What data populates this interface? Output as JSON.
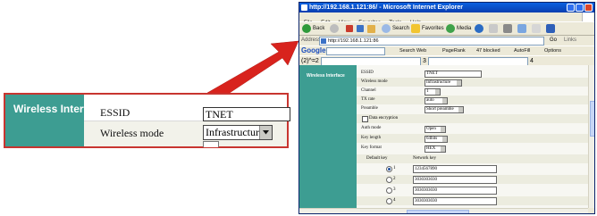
{
  "zoom": {
    "section_label": "Wireless Interface",
    "essid_label": "ESSID",
    "essid_value": "TNET",
    "wireless_mode_label": "Wireless mode",
    "wireless_mode_value": "Infrastructure"
  },
  "browser": {
    "title": "http://192.168.1.121:86/ - Microsoft Internet Explorer",
    "menu": [
      "File",
      "Edit",
      "View",
      "Favorites",
      "Tools",
      "Help"
    ],
    "toolbar": {
      "back": "Back",
      "search": "Search",
      "favorites": "Favorites",
      "media": "Media"
    },
    "address_label": "Address",
    "address_url": "http://192.168.1.121:86",
    "go_label": "Go",
    "links_label": "Links",
    "google": {
      "logo": "Google -",
      "search_web": "Search Web",
      "pagerank": "PageRank",
      "blocked": "47 blocked",
      "autofill": "AutoFill",
      "options": "Options"
    },
    "calc": {
      "expression": "(2)^=2",
      "n3": "3",
      "n4": "4"
    }
  },
  "form": {
    "section_label": "Wireless Interface",
    "essid_label": "ESSID",
    "essid_value": "TNET",
    "wireless_mode_label": "Wireless mode",
    "wireless_mode_value": "Infrastructure",
    "channel_label": "Channel",
    "channel_value": "1",
    "tx_rate_label": "TX rate",
    "tx_rate_value": "auto",
    "preamble_label": "Preamble",
    "preamble_value": "Short preamble",
    "data_encryption_label": "Data encryption",
    "auth_mode_label": "Auth mode",
    "auth_mode_value": "Open",
    "key_length_label": "Key length",
    "key_length_value": "64bits",
    "key_format_label": "Key format",
    "key_format_value": "HEX",
    "default_key_label": "Default key",
    "network_key_label": "Network key",
    "keys": [
      {
        "num": "1",
        "value": "1234567890"
      },
      {
        "num": "2",
        "value": "3030303030"
      },
      {
        "num": "3",
        "value": "3030303030"
      },
      {
        "num": "4",
        "value": "3030303030"
      }
    ]
  }
}
